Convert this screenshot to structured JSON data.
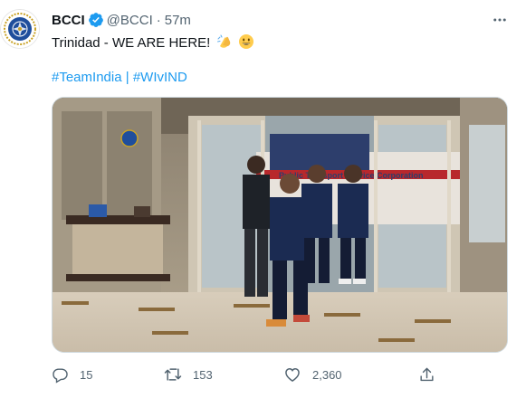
{
  "tweet": {
    "author_name": "BCCI",
    "handle": "@BCCI",
    "separator": "·",
    "time": "57m",
    "text": "Trinidad - WE ARE HERE!",
    "emojis": [
      "clapping-hands",
      "grinning-face"
    ],
    "hashtag_1": "#TeamIndia",
    "hashtag_sep": "|",
    "hashtag_2": "#WIvIND",
    "media_sign_text": "Public Transport Service Corporation"
  },
  "actions": {
    "reply_count": "15",
    "retweet_count": "153",
    "like_count": "2,360"
  },
  "icons": [
    "bcci-logo-icon",
    "verified-badge-icon",
    "more-options-icon",
    "reply-icon",
    "retweet-icon",
    "like-icon",
    "share-icon"
  ],
  "colors": {
    "link": "#1d9bf0",
    "muted": "#536471",
    "verified": "#1d9bf0",
    "text": "#0f1419"
  }
}
